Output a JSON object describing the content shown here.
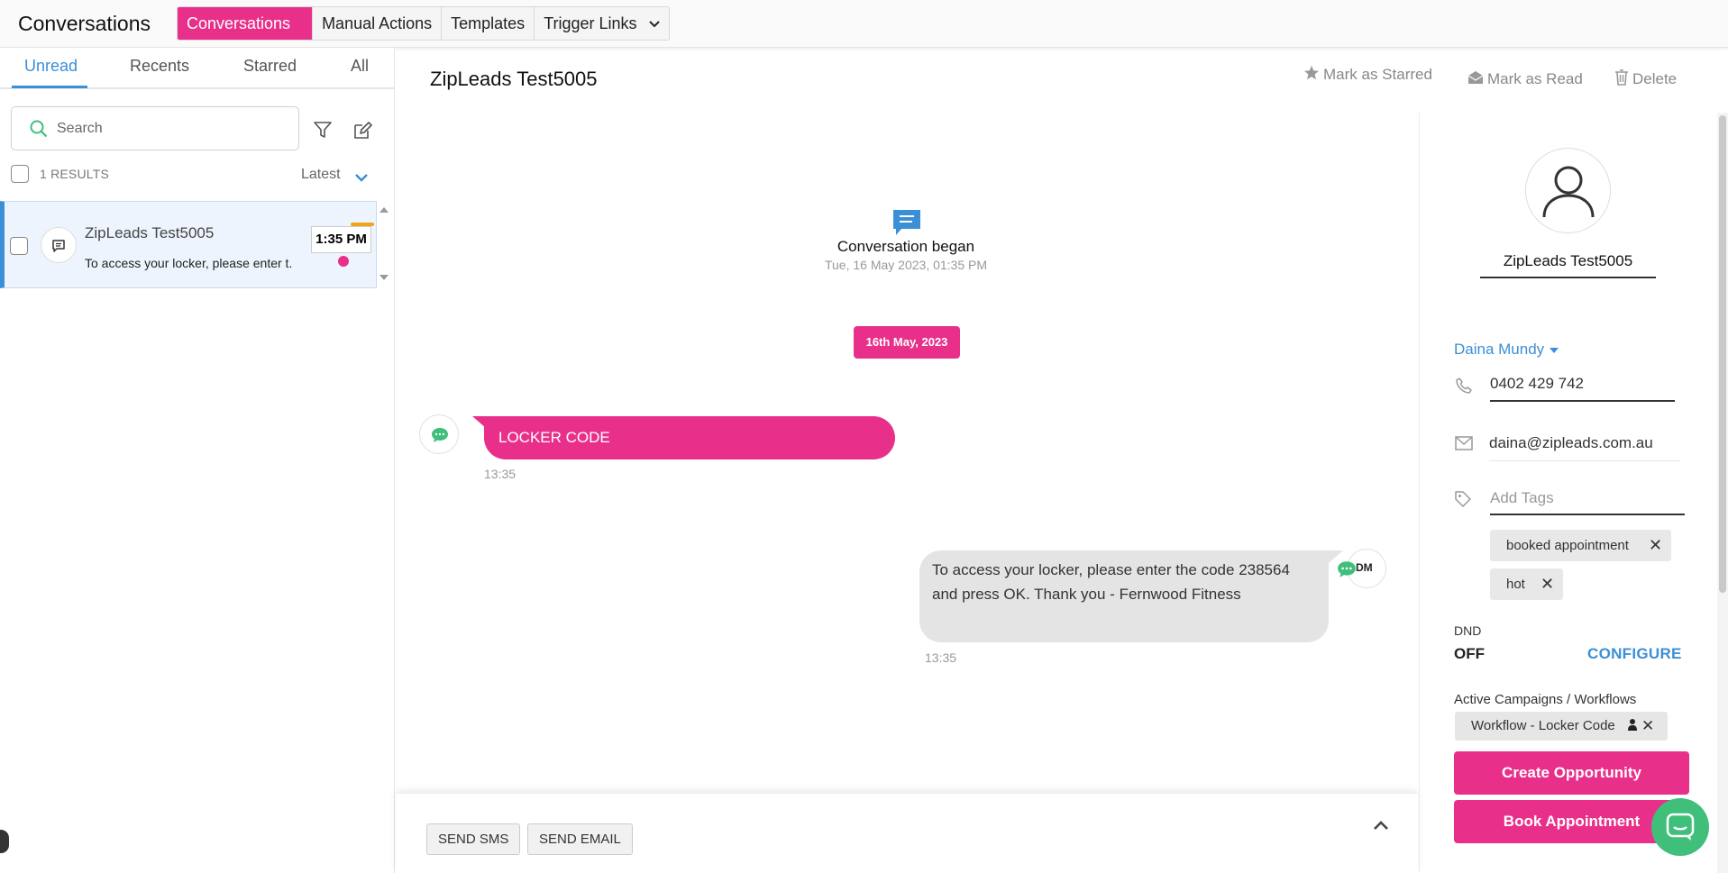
{
  "header": {
    "title": "Conversations",
    "tabs": [
      {
        "label": "Conversations",
        "active": true
      },
      {
        "label": "Manual Actions"
      },
      {
        "label": "Templates"
      },
      {
        "label": "Trigger Links",
        "has_dropdown": true
      }
    ]
  },
  "sidebar": {
    "filter_tabs": [
      "Unread",
      "Recents",
      "Starred",
      "All"
    ],
    "active_filter": "Unread",
    "search": {
      "placeholder": "Search",
      "value": ""
    },
    "results_label": "1 RESULTS",
    "sort_label": "Latest",
    "conversations": [
      {
        "name": "ZipLeads Test5005",
        "preview": "To access your locker, please enter t.",
        "time": "1:35 PM",
        "unread": true
      }
    ]
  },
  "conversation": {
    "title": "ZipLeads Test5005",
    "actions": {
      "star": "Mark as Starred",
      "read": "Mark as Read",
      "delete": "Delete"
    },
    "began_title": "Conversation began",
    "began_date": "Tue, 16 May 2023, 01:35 PM",
    "date_divider": "16th May, 2023",
    "messages": [
      {
        "direction": "inbound",
        "text": "LOCKER CODE",
        "time": "13:35"
      },
      {
        "direction": "outbound",
        "text": "To access your locker, please enter the code 238564 and press OK. Thank you - Fernwood Fitness",
        "time": "13:35",
        "sender_badge": "DM"
      }
    ],
    "composer": {
      "send_sms": "SEND SMS",
      "send_email": "SEND EMAIL"
    }
  },
  "contact": {
    "name": "ZipLeads Test5005",
    "owner": "Daina Mundy",
    "phone": "0402 429 742",
    "email": "daina@zipleads.com.au",
    "tags_placeholder": "Add Tags",
    "tags": [
      "booked appointment",
      "hot"
    ],
    "dnd_label": "DND",
    "dnd_value": "OFF",
    "configure_label": "CONFIGURE",
    "campaigns_label": "Active Campaigns / Workflows",
    "workflows": [
      "Workflow - Locker Code"
    ],
    "create_opportunity": "Create Opportunity",
    "book_appointment": "Book Appointment"
  },
  "colors": {
    "brand_pink": "#e8308a",
    "accent_blue": "#3b8fd6",
    "chat_green": "#3fbf7a",
    "time_bar_orange": "#f2a616"
  },
  "icons": [
    "search-icon",
    "filter-icon",
    "compose-icon",
    "chat-icon",
    "star-icon",
    "envelope-open-icon",
    "trash-icon",
    "phone-icon",
    "mail-icon",
    "tag-icon",
    "user-icon",
    "chevron-down-icon",
    "chevron-up-icon",
    "close-icon",
    "person-icon"
  ]
}
